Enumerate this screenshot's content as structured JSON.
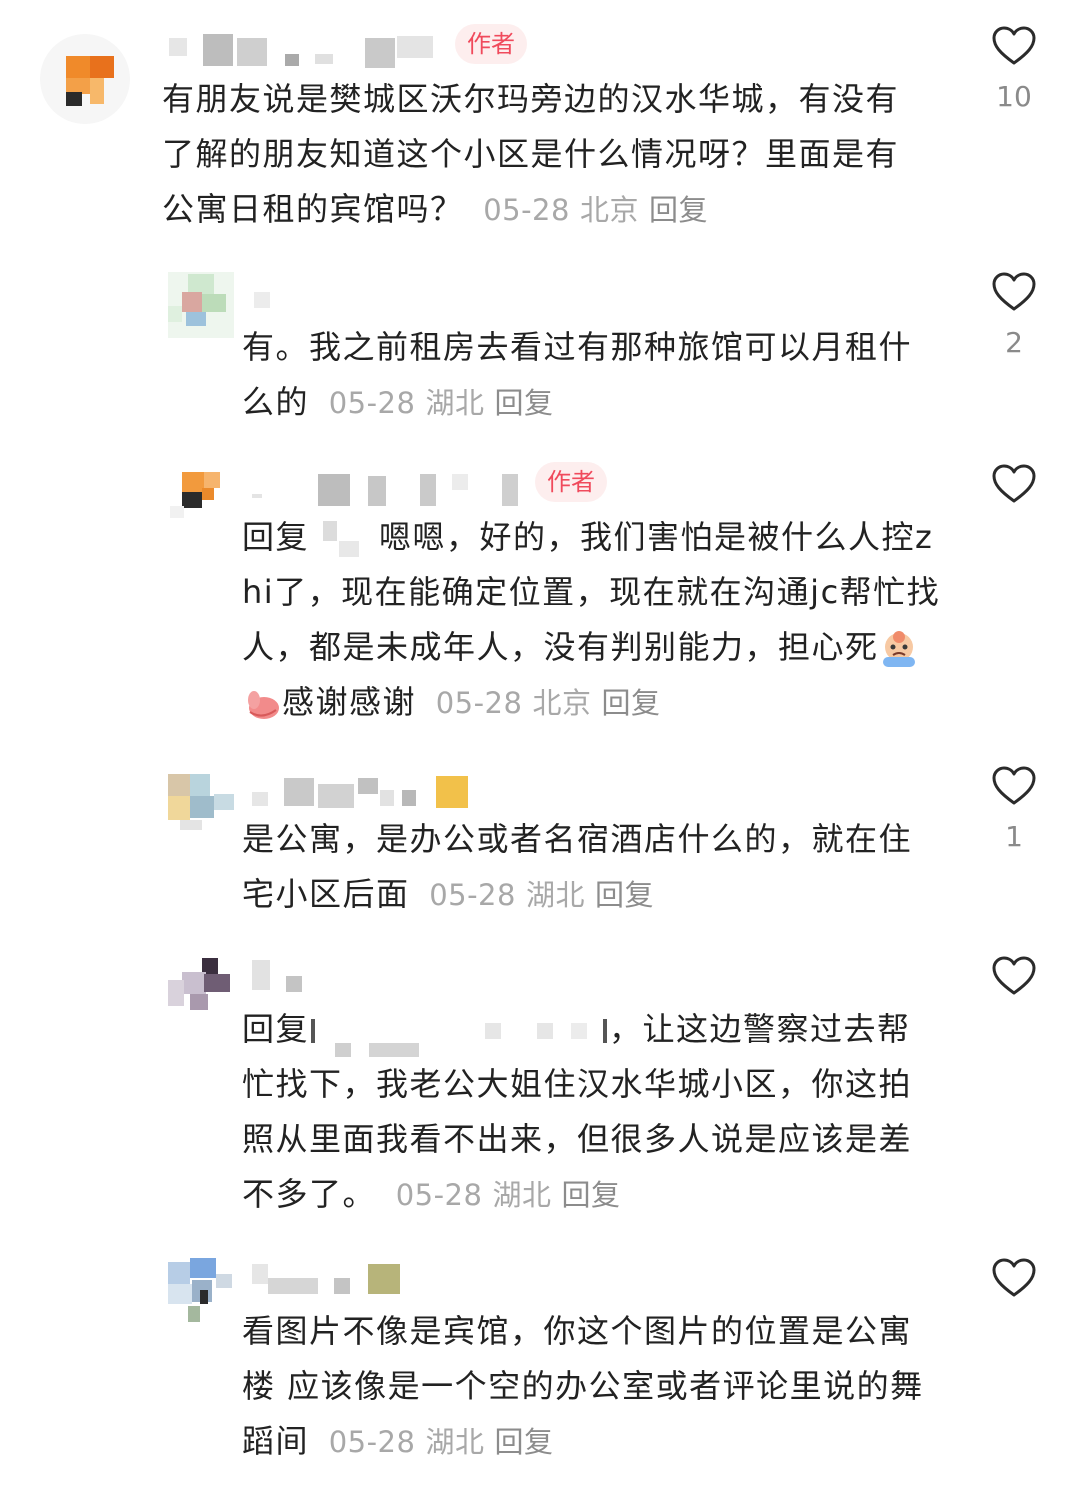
{
  "comments": [
    {
      "author_tag": "作者",
      "text": "有朋友说是樊城区沃尔玛旁边的汉水华城，有没有了解的朋友知道这个小区是什么情况呀？里面是有公寓日租的宾馆吗？",
      "date": "05-28",
      "location": "北京",
      "reply_label": "回复",
      "likes": "10"
    },
    {
      "text": "有。我之前租房去看过有那种旅馆可以月租什么的",
      "date": "05-28",
      "location": "湖北",
      "reply_label": "回复",
      "likes": "2"
    },
    {
      "author_tag": "作者",
      "reply_prefix": "回复",
      "text": "嗯嗯，好的，我们害怕是被什么人控zhi了，现在能确定位置，现在就在沟通jc帮忙找人，都是未成年人，没有判别能力，担心死",
      "text_after_emoji": "感谢感谢",
      "emojis": [
        "crying-face-emoji",
        "pointing-hand-emoji"
      ],
      "date": "05-28",
      "location": "北京",
      "reply_label": "回复",
      "likes": ""
    },
    {
      "text": "是公寓，是办公或者名宿酒店什么的，就在住宅小区后面",
      "date": "05-28",
      "location": "湖北",
      "reply_label": "回复",
      "likes": "1"
    },
    {
      "reply_prefix": "回复",
      "text": "，让这边警察过去帮忙找下，我老公大姐住汉水华城小区，你这拍照从里面我看不出来，但很多人说是应该是差不多了。",
      "date": "05-28",
      "location": "湖北",
      "reply_label": "回复",
      "likes": ""
    },
    {
      "text": "看图片不像是宾馆，你这个图片的位置是公寓楼 应该像是一个空的办公室或者评论里说的舞蹈间",
      "date": "05-28",
      "location": "湖北",
      "reply_label": "回复",
      "likes": ""
    }
  ],
  "colors": {
    "author_tag_bg": "#fdeeee",
    "author_tag_text": "#f04a5c",
    "meta": "#a8a8a8",
    "heart_outline": "#2b2b2b"
  }
}
